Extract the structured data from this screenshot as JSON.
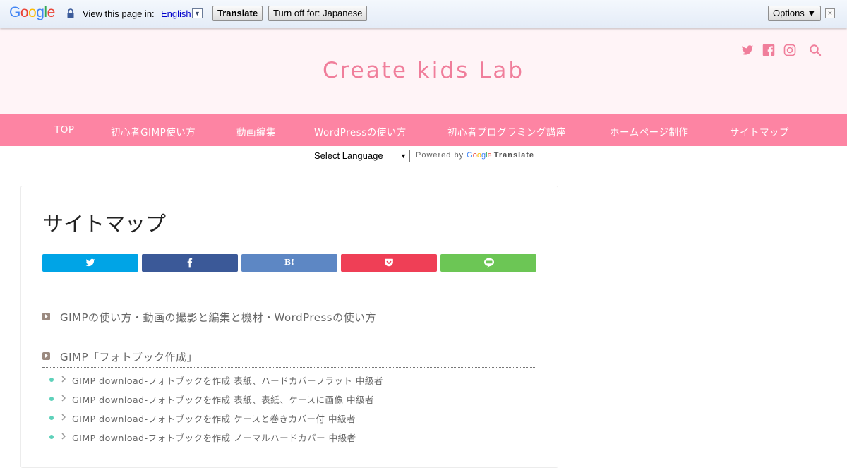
{
  "translate_bar": {
    "logo": "Google",
    "logo_colors": [
      "#4285f4",
      "#ea4335",
      "#fbbc05",
      "#4285f4",
      "#34a853",
      "#ea4335"
    ],
    "view_text": "View this page in:",
    "language": "English",
    "translate_label": "Translate",
    "turn_off_label": "Turn off for: Japanese",
    "options_label": "Options ▼",
    "close_label": "×"
  },
  "header": {
    "site_title": "Create kids Lab",
    "icons": [
      "twitter-icon",
      "facebook-icon",
      "instagram-icon",
      "search-icon"
    ],
    "accent_color": "#f07e9b"
  },
  "nav": {
    "color": "#fd84a3",
    "items": [
      "TOP",
      "初心者GIMP使い方",
      "動画編集",
      "WordPressの使い方",
      "初心者プログラミング講座",
      "ホームページ制作",
      "サイトマップ"
    ]
  },
  "google_translate": {
    "select_label": "Select Language",
    "powered_by": "Powered by",
    "google_logo": "Google",
    "translate_word": "Translate"
  },
  "main": {
    "page_title": "サイトマップ",
    "share_buttons": [
      {
        "name": "twitter",
        "color": "#00a4e6"
      },
      {
        "name": "facebook",
        "color": "#3b5998"
      },
      {
        "name": "hatena",
        "label": "B!",
        "color": "#5d87c4"
      },
      {
        "name": "pocket",
        "color": "#ef3f56"
      },
      {
        "name": "line",
        "color": "#6cc655"
      }
    ],
    "sections": [
      {
        "title": "GIMPの使い方・動画の撮影と編集と機材・WordPressの使い方",
        "items": []
      },
      {
        "title": "GIMP「フォトブック作成」",
        "items": [
          "GIMP download-フォトブックを作成 表紙、ハードカバーフラット 中級者",
          "GIMP download-フォトブックを作成 表紙、表紙、ケースに画像 中級者",
          "GIMP download-フォトブックを作成 ケースと巻きカバー付 中級者",
          "GIMP download-フォトブックを作成 ノーマルハードカバー 中級者"
        ]
      }
    ]
  }
}
